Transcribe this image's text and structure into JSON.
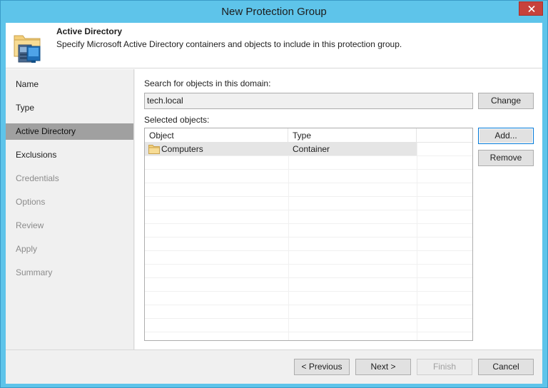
{
  "window": {
    "title": "New Protection Group"
  },
  "header": {
    "title": "Active Directory",
    "description": "Specify Microsoft Active Directory containers and objects to include in this protection group."
  },
  "nav": {
    "items": [
      {
        "label": "Name",
        "state": "normal"
      },
      {
        "label": "Type",
        "state": "normal"
      },
      {
        "label": "Active Directory",
        "state": "active"
      },
      {
        "label": "Exclusions",
        "state": "normal"
      },
      {
        "label": "Credentials",
        "state": "disabled"
      },
      {
        "label": "Options",
        "state": "disabled"
      },
      {
        "label": "Review",
        "state": "disabled"
      },
      {
        "label": "Apply",
        "state": "disabled"
      },
      {
        "label": "Summary",
        "state": "disabled"
      }
    ]
  },
  "main": {
    "search_label": "Search for objects in this domain:",
    "domain_value": "tech.local",
    "change_label": "Change",
    "selected_label": "Selected objects:",
    "add_label": "Add...",
    "remove_label": "Remove",
    "table": {
      "columns": [
        "Object",
        "Type"
      ],
      "rows": [
        {
          "object": "Computers",
          "type": "Container",
          "icon": "folder-icon"
        }
      ]
    }
  },
  "footer": {
    "previous_label": "< Previous",
    "next_label": "Next >",
    "finish_label": "Finish",
    "cancel_label": "Cancel"
  },
  "colors": {
    "titlebar": "#5ec4ea",
    "close": "#c7423b",
    "nav_active": "#a0a0a0",
    "focus_border": "#0078d7"
  }
}
